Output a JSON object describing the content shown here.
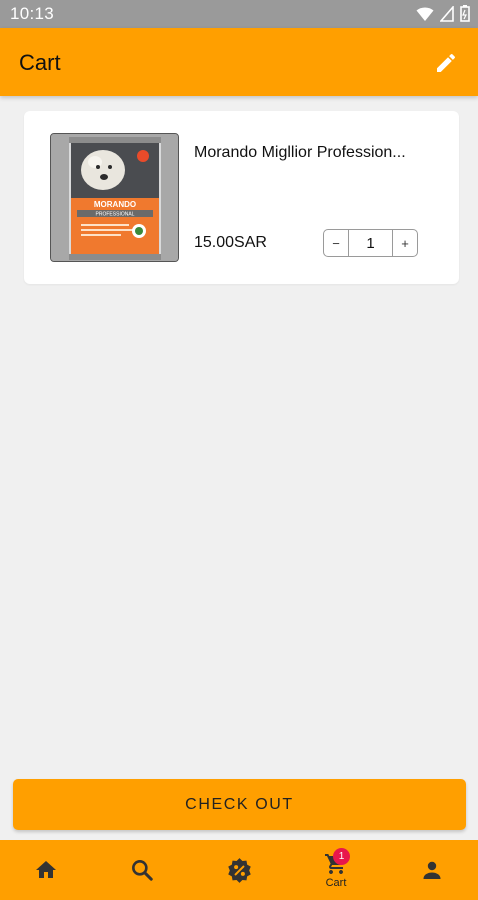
{
  "status_bar": {
    "time": "10:13"
  },
  "app_bar": {
    "title": "Cart",
    "edit_icon": "pencil-icon"
  },
  "cart": {
    "items": [
      {
        "name": "Morando Migllior Profession...",
        "price": "15.00SAR",
        "quantity": "1",
        "decrement": "−",
        "increment": "+"
      }
    ]
  },
  "product_image": {
    "brand": "MORANDO",
    "line": "PROFESSIONAL"
  },
  "checkout_button": {
    "label": "CHECK OUT"
  },
  "bottom_nav": {
    "items": [
      {
        "icon": "home-icon"
      },
      {
        "icon": "search-icon"
      },
      {
        "icon": "offers-badge-icon"
      },
      {
        "icon": "cart-icon",
        "label": "Cart",
        "badge": "1"
      },
      {
        "icon": "person-icon"
      }
    ]
  },
  "colors": {
    "accent": "#ff9f00",
    "badge": "#e8174c",
    "status_bar": "#9a9a9a",
    "background": "#f0f0f0"
  }
}
